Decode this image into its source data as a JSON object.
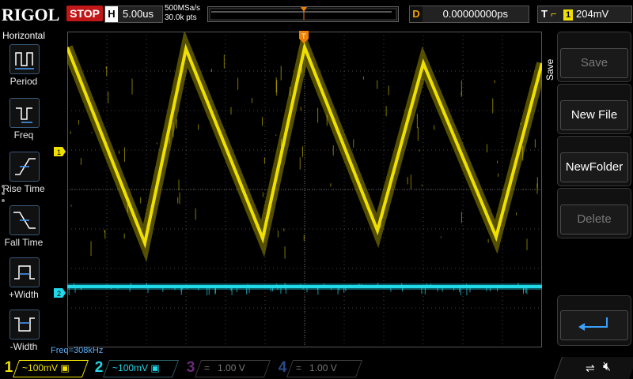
{
  "header": {
    "brand": "RIGOL",
    "run_state": "STOP",
    "horizontal": {
      "label": "H",
      "timebase": "5.00us"
    },
    "sample_rate": "500MSa/s",
    "memory_depth": "30.0k pts",
    "delay": {
      "label": "D",
      "value": "0.00000000ps"
    },
    "trigger": {
      "label": "T",
      "source": "1",
      "level": "204mV"
    }
  },
  "left_menu": {
    "title": "Horizontal",
    "items": [
      {
        "label": "Period",
        "icon": "period-icon"
      },
      {
        "label": "Freq",
        "icon": "freq-icon"
      },
      {
        "label": "Rise Time",
        "icon": "rise-time-icon"
      },
      {
        "label": "Fall Time",
        "icon": "fall-time-icon"
      },
      {
        "label": "+Width",
        "icon": "positive-width-icon"
      },
      {
        "label": "-Width",
        "icon": "negative-width-icon"
      }
    ]
  },
  "right_menu": {
    "title": "Save",
    "keys": [
      {
        "label": "Save",
        "state": "disabled"
      },
      {
        "label": "New File",
        "state": "enabled"
      },
      {
        "label": "NewFolder",
        "state": "enabled"
      },
      {
        "label": "Delete",
        "state": "disabled"
      },
      {
        "label": "",
        "icon": "enter-icon",
        "state": "enabled"
      }
    ]
  },
  "waveform": {
    "ch1_marker": "1",
    "ch2_marker": "2",
    "trigger_marker": "T",
    "measurement": "Freq=308kHz"
  },
  "channels": [
    {
      "num": "1",
      "coupling": "~",
      "scale": "100mV"
    },
    {
      "num": "2",
      "coupling": "~",
      "scale": "100mV"
    },
    {
      "num": "3",
      "coupling": "=",
      "scale": "1.00 V"
    },
    {
      "num": "4",
      "coupling": "=",
      "scale": "1.00 V"
    }
  ],
  "colors": {
    "ch1": "#f0e000",
    "ch2": "#20d8e8",
    "stop": "#c01818",
    "measurement": "#5ab0ff"
  }
}
